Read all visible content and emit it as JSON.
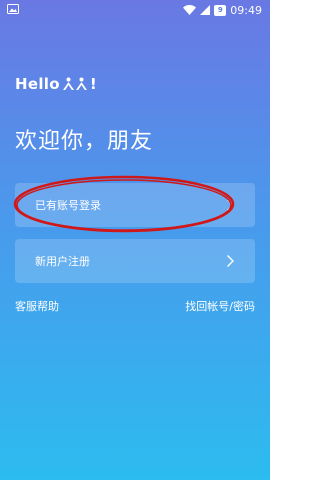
{
  "status_bar": {
    "time": "09:49",
    "battery_level": "9",
    "icons": [
      "image-notification-icon",
      "wifi-icon",
      "signal-icon",
      "battery-icon"
    ]
  },
  "logo": {
    "text": "Hello",
    "suffix": "!"
  },
  "welcome": {
    "title": "欢迎你，朋友"
  },
  "buttons": {
    "existing_account": "已有账号登录",
    "new_user": "新用户注册"
  },
  "links": {
    "support": "客服帮助",
    "recover": "找回帐号/密码"
  },
  "colors": {
    "gradient_top": "#6a78e4",
    "gradient_bottom": "#2cbcef",
    "annotation": "#d01818"
  }
}
